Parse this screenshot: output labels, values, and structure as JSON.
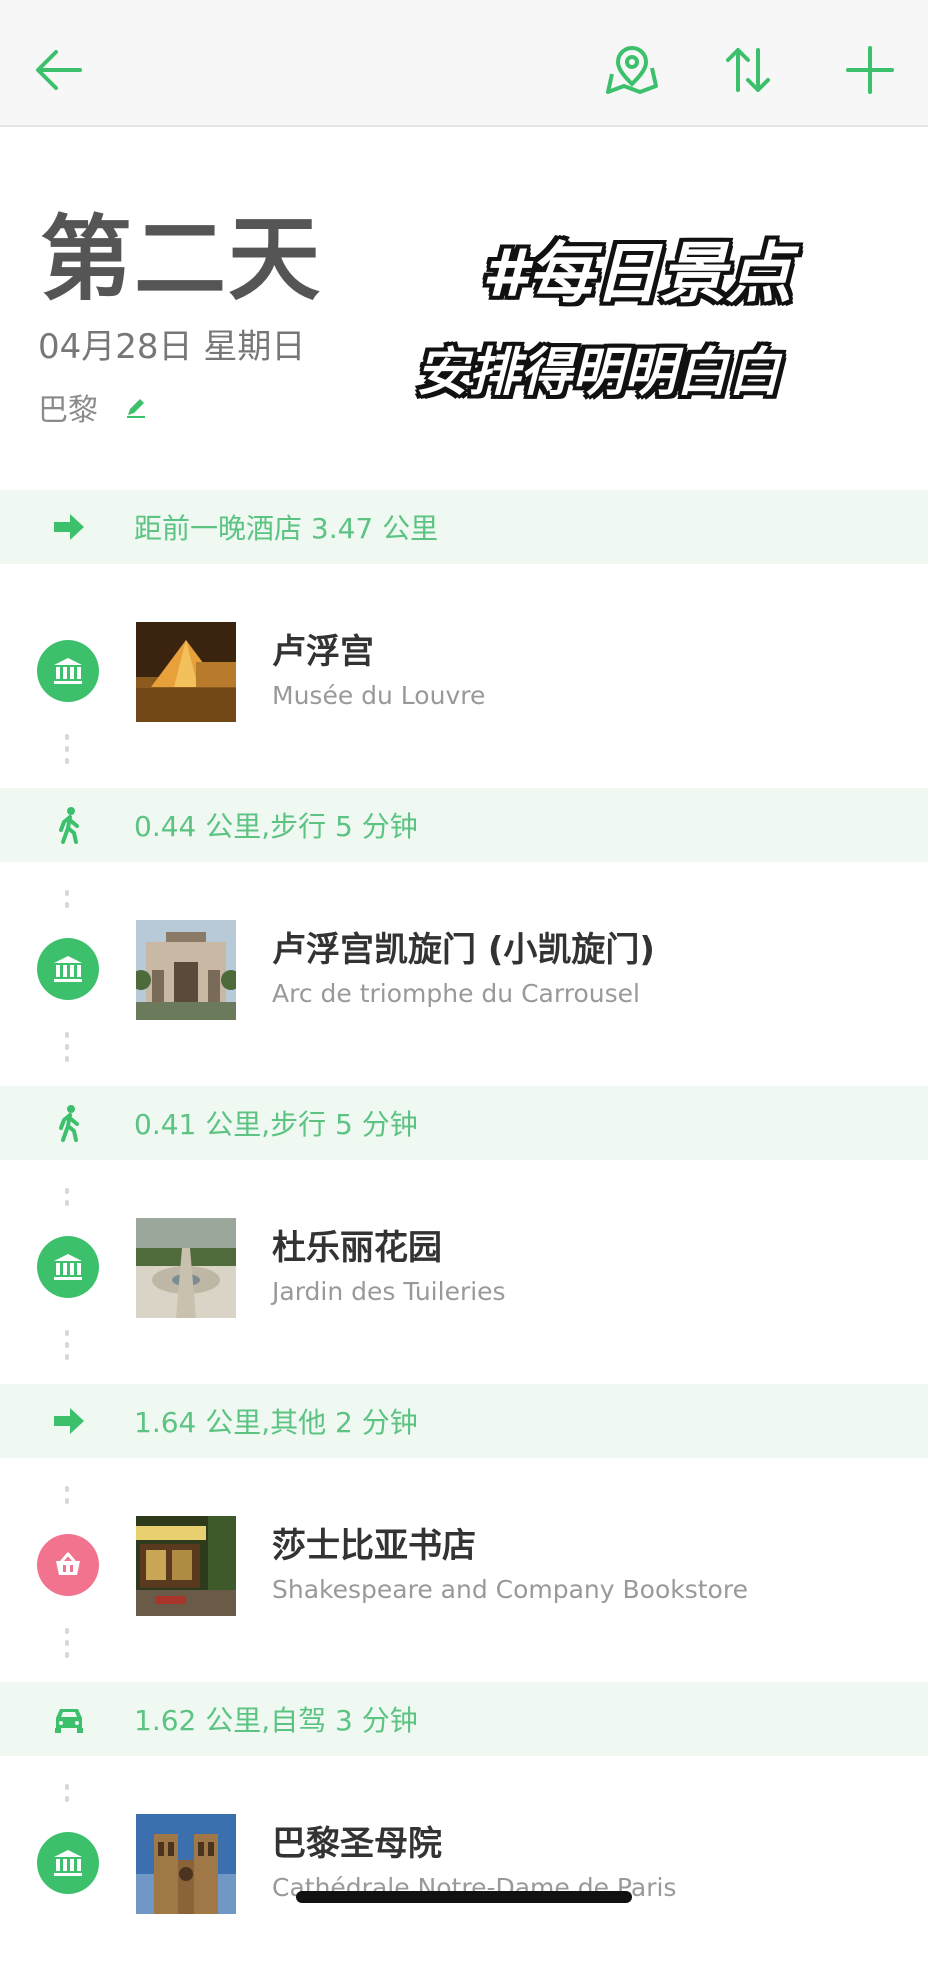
{
  "title": "第二天",
  "date": "04月28日 星期日",
  "city": "巴黎",
  "overlay_line1": "#每日景点",
  "overlay_line2": "安排得明明白白",
  "colors": {
    "accent": "#3cc06c",
    "transit_bg": "#eff9f2",
    "transit_text": "#5cc383",
    "shop": "#f2738e"
  },
  "toolbar": {
    "icons": [
      "back-arrow-icon",
      "map-pin-icon",
      "sort-icon",
      "add-icon"
    ]
  },
  "transits": [
    {
      "icon": "arrow-right-icon",
      "text": "距前一晚酒店 3.47 公里"
    },
    {
      "icon": "walk-icon",
      "text": "0.44 公里,步行 5 分钟"
    },
    {
      "icon": "walk-icon",
      "text": "0.41 公里,步行 5 分钟"
    },
    {
      "icon": "arrow-right-icon",
      "text": "1.64 公里,其他 2 分钟"
    },
    {
      "icon": "car-icon",
      "text": "1.62 公里,自驾 3 分钟"
    }
  ],
  "places": [
    {
      "name": "卢浮宫",
      "sub": "Musée du Louvre",
      "category": "museum-icon"
    },
    {
      "name": "卢浮宫凯旋门 (小凯旋门)",
      "sub": "Arc de triomphe du Carrousel",
      "category": "museum-icon"
    },
    {
      "name": "杜乐丽花园",
      "sub": "Jardin des Tuileries",
      "category": "museum-icon"
    },
    {
      "name": "莎士比亚书店",
      "sub": "Shakespeare and Company Bookstore",
      "category": "shopping-basket-icon"
    },
    {
      "name": "巴黎圣母院",
      "sub": "Cathédrale Notre-Dame de Paris",
      "category": "museum-icon"
    }
  ]
}
